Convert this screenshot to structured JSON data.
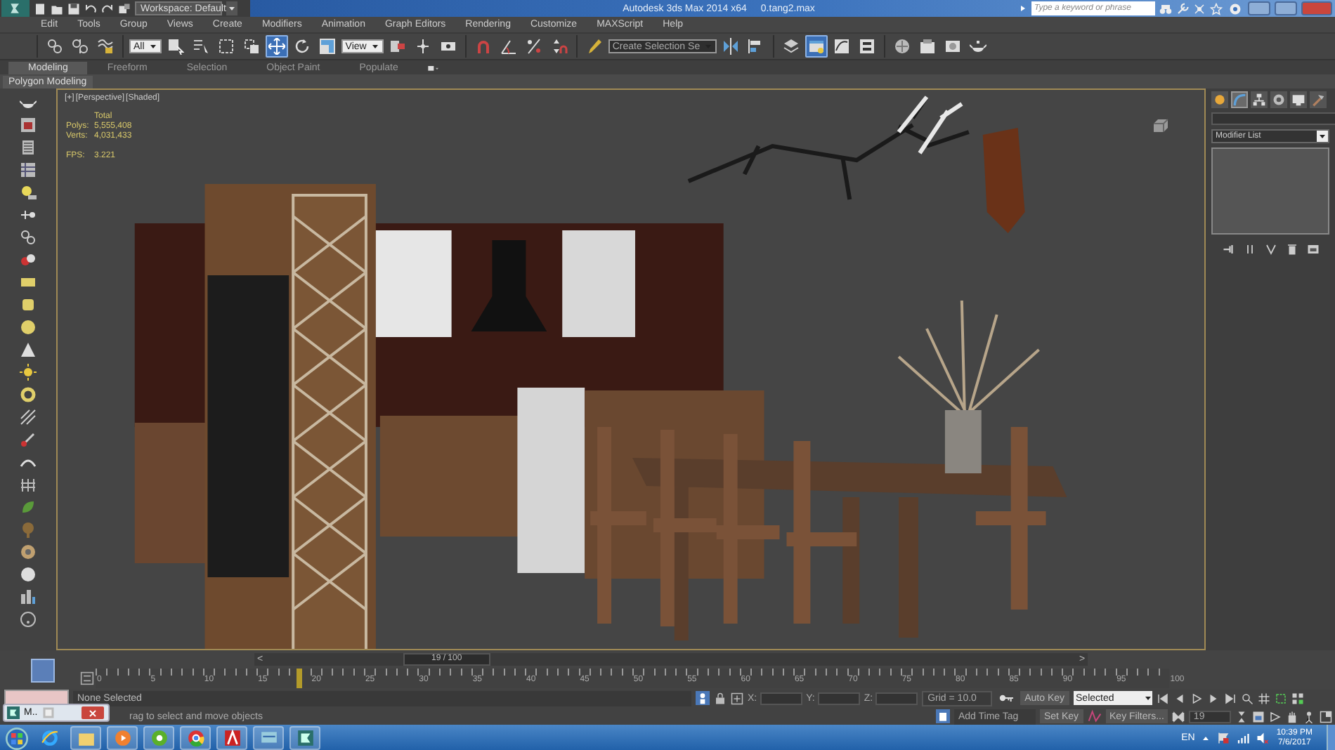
{
  "title_bar": {
    "workspace": "Workspace: Default",
    "title": "Autodesk 3ds Max 2014 x64",
    "file": "0.tang2.max",
    "search": {
      "placeholder": "Type a keyword or phrase"
    }
  },
  "menu": [
    "Edit",
    "Tools",
    "Group",
    "Views",
    "Create",
    "Modifiers",
    "Animation",
    "Graph Editors",
    "Rendering",
    "Customize",
    "MAXScript",
    "Help"
  ],
  "toolbar": [
    [
      {
        "kind": "link",
        "selected": false
      },
      {
        "kind": "unlink",
        "selected": false
      },
      {
        "kind": "bind",
        "selected": false
      }
    ],
    [
      {
        "kind": "dropdown",
        "value": "All"
      },
      {
        "kind": "select",
        "selected": false
      },
      {
        "kind": "select-by-name",
        "selected": false
      },
      {
        "kind": "region",
        "selected": false
      },
      {
        "kind": "crossing",
        "selected": false
      },
      {
        "kind": "move",
        "selected": true
      },
      {
        "kind": "rotate",
        "selected": false
      },
      {
        "kind": "scale",
        "selected": false
      },
      {
        "kind": "dropdown",
        "value": "View"
      },
      {
        "kind": "pivot",
        "selected": false
      },
      {
        "kind": "manipulate",
        "selected": false
      },
      {
        "kind": "keyboard",
        "selected": false
      }
    ],
    [
      {
        "kind": "snap",
        "selected": false
      },
      {
        "kind": "angle-snap",
        "selected": false
      },
      {
        "kind": "percent-snap",
        "selected": false
      },
      {
        "kind": "spinner-snap",
        "selected": false
      }
    ],
    [
      {
        "kind": "edit-named",
        "selected": false
      },
      {
        "kind": "dropdown",
        "value": "Create Selection Se"
      },
      {
        "kind": "mirror",
        "selected": false
      },
      {
        "kind": "align",
        "selected": false
      }
    ],
    [
      {
        "kind": "layers",
        "selected": false
      },
      {
        "kind": "ribbon",
        "selected": true
      },
      {
        "kind": "curve",
        "selected": false
      },
      {
        "kind": "schematic",
        "selected": false
      }
    ],
    [
      {
        "kind": "material",
        "selected": false
      },
      {
        "kind": "render-setup",
        "selected": false
      },
      {
        "kind": "frame-window",
        "selected": false
      },
      {
        "kind": "render",
        "selected": false
      }
    ]
  ],
  "ribbon": {
    "tabs": [
      {
        "label": "Modeling",
        "selected": true
      },
      {
        "label": "Freeform",
        "selected": false
      },
      {
        "label": "Selection",
        "selected": false
      },
      {
        "label": "Object Paint",
        "selected": false
      },
      {
        "label": "Populate",
        "selected": false
      }
    ],
    "panel": "Polygon Modeling"
  },
  "viewport": {
    "labels": [
      "[+]",
      "[Perspective]",
      "[Shaded]"
    ],
    "stats_header": "Total",
    "stats": [
      {
        "label": "Polys:",
        "value": "5,555,408"
      },
      {
        "label": "Verts:",
        "value": "4,031,433"
      }
    ],
    "fps": {
      "label": "FPS:",
      "value": "3.221"
    }
  },
  "command_panel": {
    "tabs": [
      {
        "kind": "create",
        "selected": false
      },
      {
        "kind": "modify",
        "selected": true
      },
      {
        "kind": "hierarchy",
        "selected": false
      },
      {
        "kind": "motion",
        "selected": false
      },
      {
        "kind": "display",
        "selected": false
      },
      {
        "kind": "utilities",
        "selected": false
      }
    ],
    "modifier_list": "Modifier List"
  },
  "timeline": {
    "previous": "<",
    "frame_label": "19 / 100",
    "next": ">",
    "level": 0.19,
    "ticks": [
      "0",
      "5",
      "10",
      "15",
      "20",
      "25",
      "30",
      "35",
      "40",
      "45",
      "50",
      "55",
      "60",
      "65",
      "70",
      "75",
      "80",
      "85",
      "90",
      "95",
      "100"
    ]
  },
  "status": {
    "selection": "None Selected",
    "prompt": "rag to select and move objects",
    "coords": [
      "X:",
      "Y:",
      "Z:"
    ],
    "grid": "Grid = 10.0",
    "add_time_tag": "Add Time Tag",
    "auto_key": "Auto Key",
    "key_mode": "Selected",
    "set_key": "Set Key",
    "key_filters": "Key Filters...",
    "current_frame": "19"
  },
  "thumbnail_popup": {
    "title": "M.."
  },
  "taskbar": {
    "language": "EN",
    "time": "10:39 PM",
    "date": "7/6/2017"
  }
}
